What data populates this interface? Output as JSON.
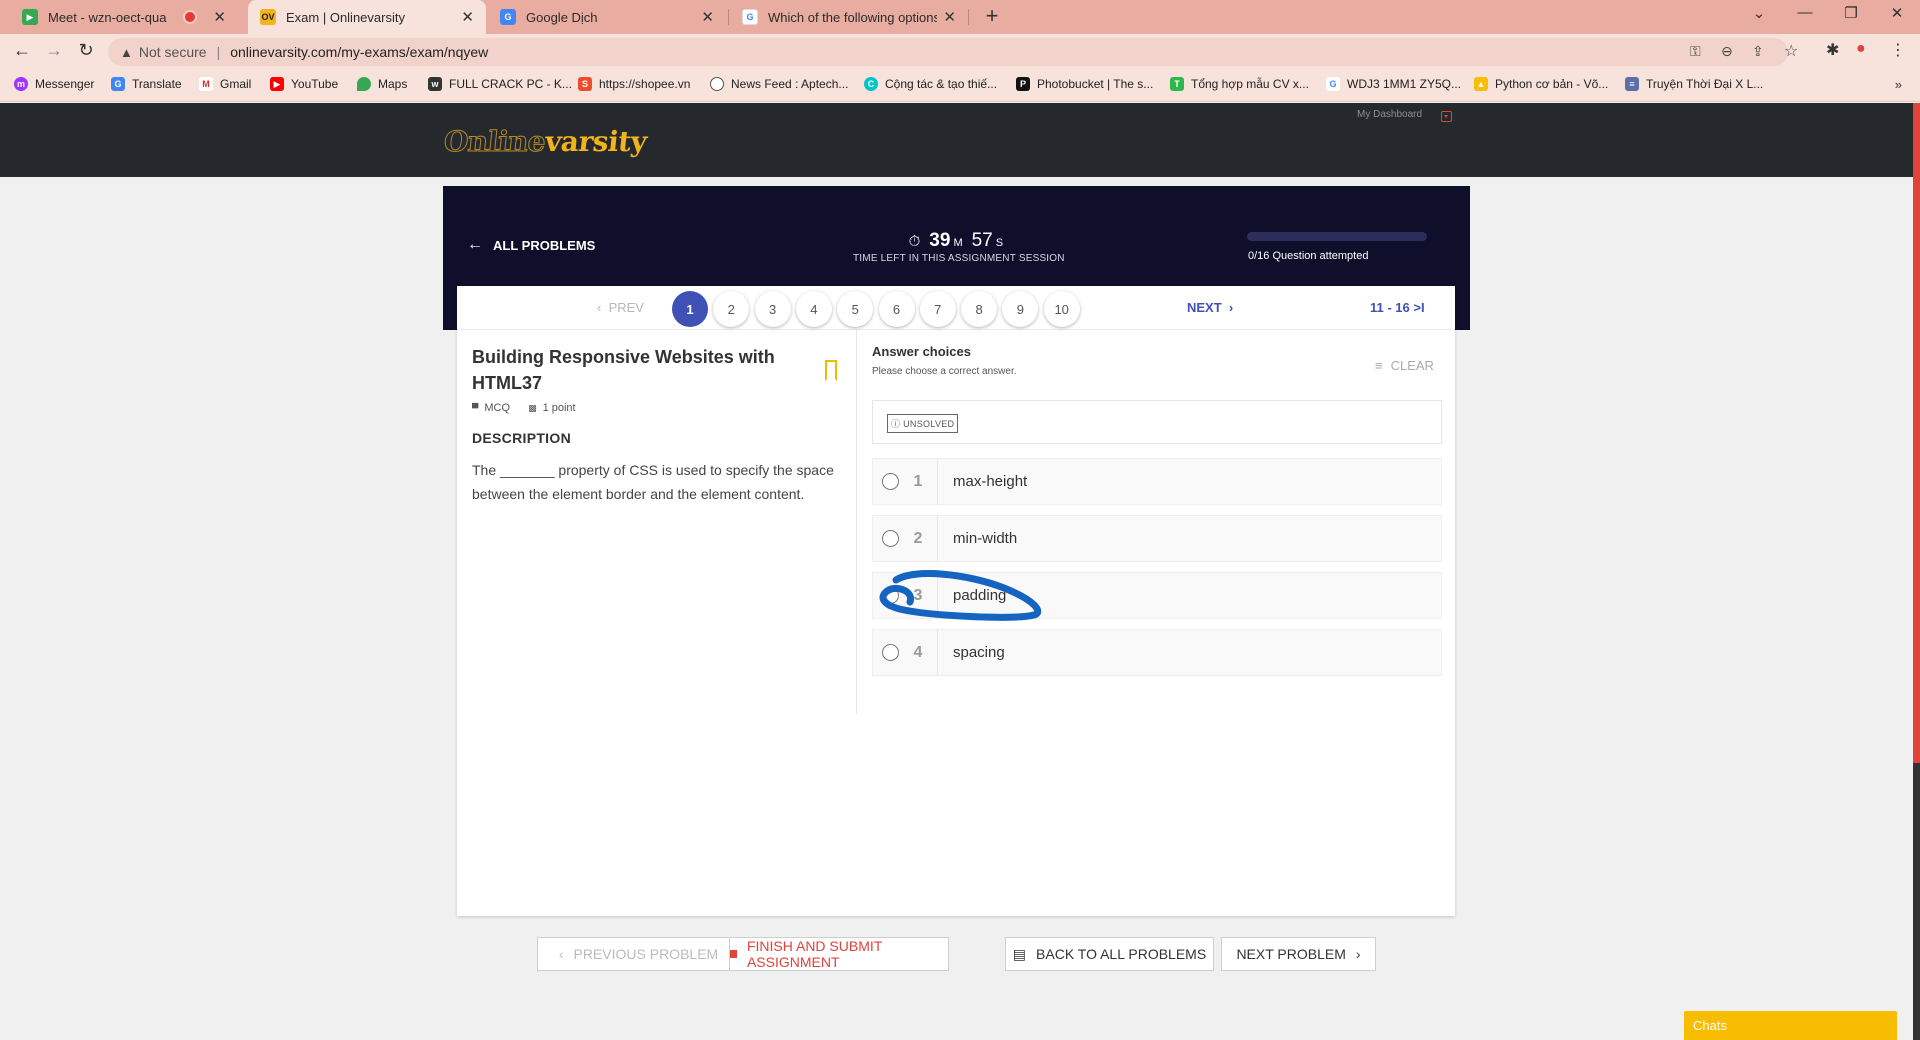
{
  "browser": {
    "tabs": [
      {
        "title": "Meet - wzn-oect-qua",
        "favicon": "meet-icon",
        "recording": true
      },
      {
        "title": "Exam | Onlinevarsity",
        "favicon": "ov-icon",
        "favicon_text": "OV",
        "active": true
      },
      {
        "title": "Google Dịch",
        "favicon": "google-translate-icon"
      },
      {
        "title": "Which of the following options a",
        "favicon": "google-icon"
      }
    ],
    "omnibox": {
      "security_label": "Not secure",
      "url": "onlinevarsity.com/my-exams/exam/nqyew"
    },
    "bookmarks": [
      "Messenger",
      "Translate",
      "Gmail",
      "YouTube",
      "Maps",
      "FULL CRACK PC - K...",
      "https://shopee.vn",
      "News Feed : Aptech...",
      "Cộng tác & tạo thiế...",
      "Photobucket | The s...",
      "Tổng hợp mẫu CV x...",
      "WDJ3 1MM1 ZY5Q...",
      "Python cơ bản - Võ...",
      "Truyện Thời Đại X L..."
    ]
  },
  "site": {
    "logo_part1": "Online",
    "logo_part2": "varsity",
    "dashboard_label": "My Dashboard"
  },
  "exam": {
    "all_problems_label": "ALL PROBLEMS",
    "timer": {
      "minutes": "39",
      "minutes_unit": "M",
      "seconds": "57",
      "seconds_unit": "S",
      "label": "TIME LEFT IN THIS ASSIGNMENT SESSION"
    },
    "progress": {
      "attempted": 0,
      "total": 16,
      "label": "0/16 Question attempted"
    },
    "pager": {
      "prev_label": "PREV",
      "next_label": "NEXT",
      "pages": [
        "1",
        "2",
        "3",
        "4",
        "5",
        "6",
        "7",
        "8",
        "9",
        "10"
      ],
      "current": "1",
      "range_label": "11 - 16"
    }
  },
  "problem": {
    "title": "Building Responsive Websites with HTML37",
    "type": "MCQ",
    "points": "1 point",
    "description_heading": "DESCRIPTION",
    "description": "The _______ property of CSS is used to specify the space between the element border and the element content."
  },
  "answers": {
    "heading": "Answer choices",
    "instruction": "Please choose a correct answer.",
    "clear_label": "CLEAR",
    "status": "UNSOLVED",
    "options": [
      {
        "num": "1",
        "text": "max-height"
      },
      {
        "num": "2",
        "text": "min-width"
      },
      {
        "num": "3",
        "text": "padding",
        "annotated": true
      },
      {
        "num": "4",
        "text": "spacing"
      }
    ],
    "annotation_color": "#1565c0"
  },
  "footer_buttons": {
    "previous": "PREVIOUS PROBLEM",
    "finish": "FINISH AND SUBMIT ASSIGNMENT",
    "back": "BACK TO ALL PROBLEMS",
    "next": "NEXT PROBLEM"
  },
  "chat_widget": "Chats",
  "colors": {
    "tab_bar": "#e8ada0",
    "banner": "#0f0f2b",
    "accent_blue": "#3f51b5",
    "accent_red": "#e0433a",
    "brand_yellow": "#f2b31b",
    "chat": "#f9bd00"
  }
}
